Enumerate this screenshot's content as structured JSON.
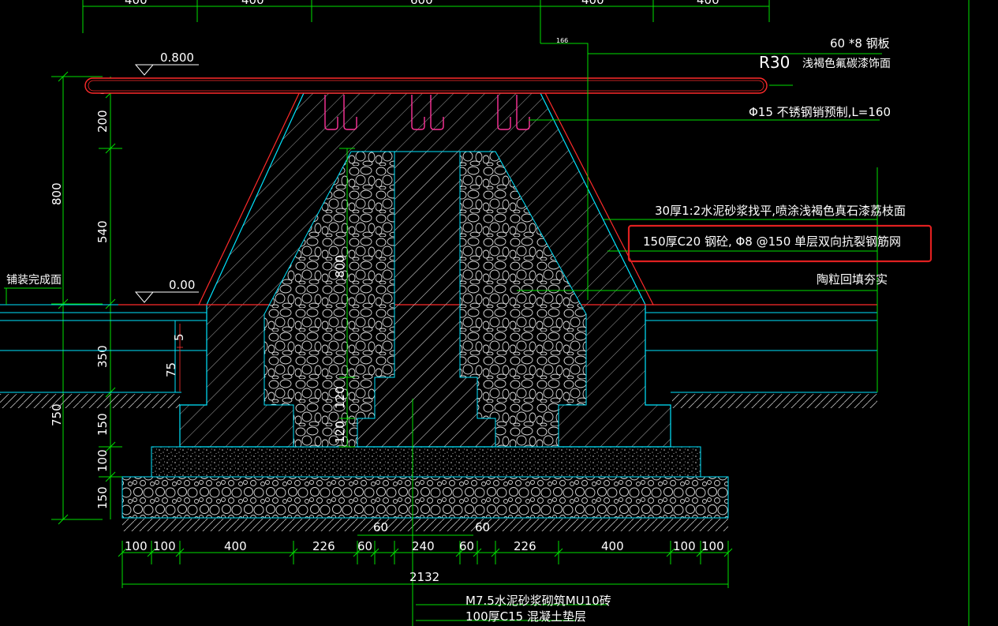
{
  "colors": {
    "background": "#000000",
    "dimension": "#00e000",
    "outline_red": "#ff2a2a",
    "structure_cyan": "#00e5ff",
    "text": "#ffffff",
    "rebar": "#ff3399",
    "highlight_box": "#e02020"
  },
  "top_dims": [
    "400",
    "400",
    "600",
    "400",
    "400"
  ],
  "levels": {
    "top": "0.800",
    "ground": "0.00"
  },
  "left_dims": {
    "plate": "60",
    "cap": "200",
    "total_upper": "800",
    "slope": "540",
    "base": "350",
    "total_lower": "750",
    "step": "150",
    "cushion": "100",
    "gravel": "150"
  },
  "inner_dims": {
    "height": "800",
    "step_a": "120",
    "step_b": "120",
    "small_a": "5",
    "small_b": "75"
  },
  "bottom_dims": {
    "labels": [
      "100",
      "100",
      "400",
      "226",
      "60",
      "240",
      "60",
      "226",
      "400",
      "100",
      "100"
    ],
    "upper_60_left": "60",
    "upper_60_right": "60",
    "total": "2132"
  },
  "annotations": {
    "steel_plate": "60 *8 钢板",
    "radius": "R30",
    "coating": "浅褐色氟碳漆饰面",
    "pin": "Φ15 不锈钢销预制,L=160",
    "leader_dim": "166",
    "mortar": "30厚1:2水泥砂浆找平,喷涂浅褐色真石漆荔枝面",
    "concrete": "150厚C20 钢砼, Φ8 @150 单层双向抗裂钢筋网",
    "backfill": "陶粒回填夯实",
    "paving": "铺装完成面",
    "brick": "M7.5水泥砂浆砌筑MU10砖",
    "cushion": "100厚C15 混凝土垫层"
  }
}
